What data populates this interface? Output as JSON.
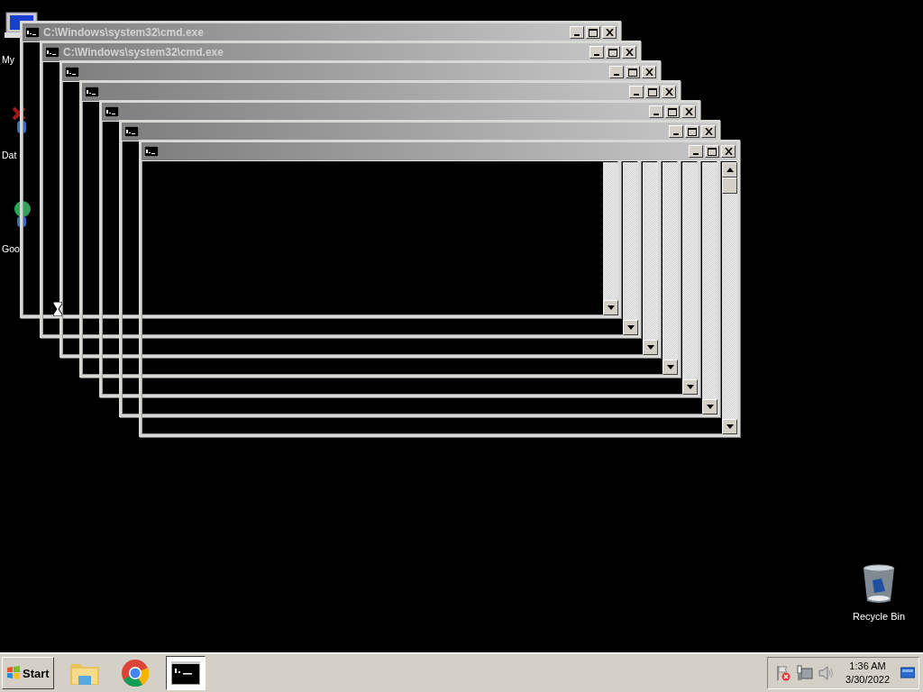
{
  "desktop_icons": [
    {
      "kind": "computer",
      "label": "My"
    },
    {
      "kind": "database",
      "label": "Dat"
    },
    {
      "kind": "browser",
      "label": "Goo"
    }
  ],
  "recycle_bin": {
    "label": "Recycle Bin"
  },
  "windows": [
    {
      "kind": "console",
      "title": "C:\\Windows\\system32\\cmd.exe"
    },
    {
      "kind": "console",
      "title": "C:\\Windows\\system32\\cmd.exe"
    },
    {
      "kind": "console"
    },
    {
      "kind": "console"
    },
    {
      "kind": "console"
    },
    {
      "kind": "console"
    },
    {
      "kind": "console"
    }
  ],
  "taskbar": {
    "start_button": {
      "label": "Start"
    },
    "items": [
      {
        "kind": "folder",
        "selected": false
      },
      {
        "kind": "browser",
        "selected": false
      },
      {
        "kind": "console",
        "selected": true
      }
    ],
    "tray": {
      "time": "1:36 AM",
      "date": "3/30/2022"
    }
  }
}
